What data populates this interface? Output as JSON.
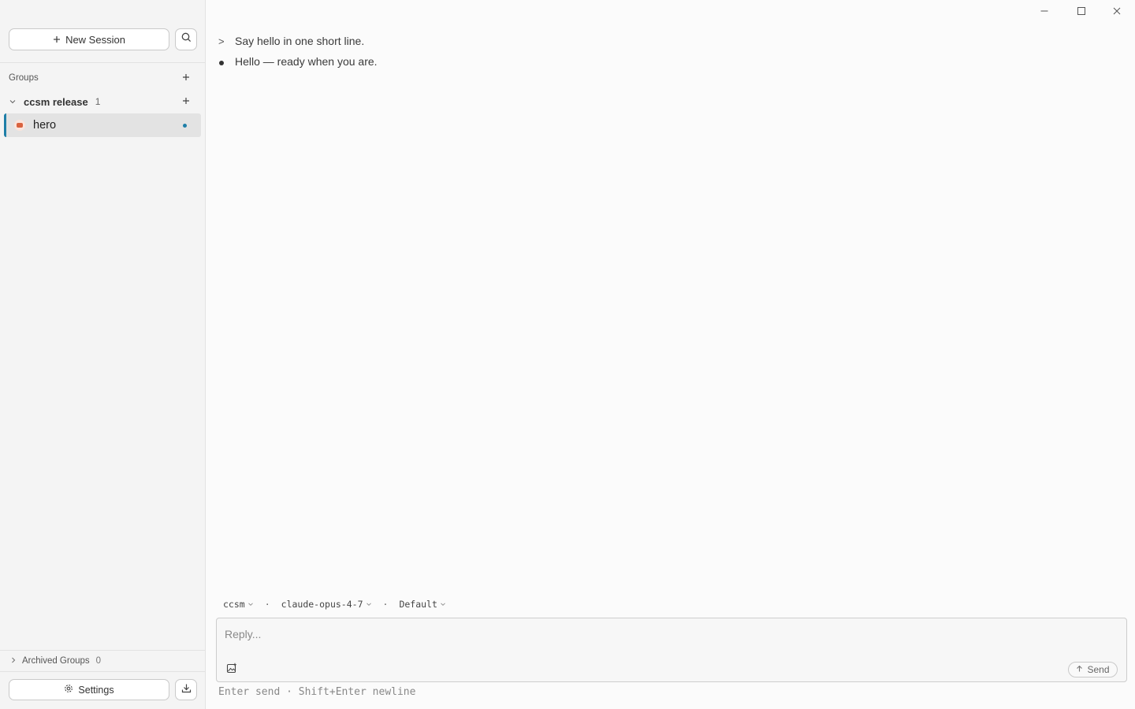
{
  "sidebar": {
    "new_session_label": "New Session",
    "groups_label": "Groups",
    "group": {
      "name": "ccsm release",
      "count": "1"
    },
    "session": {
      "name": "hero"
    },
    "archived": {
      "label": "Archived Groups",
      "count": "0"
    },
    "settings_label": "Settings"
  },
  "chat": {
    "user_marker": ">",
    "user_message": "Say hello in one short line.",
    "assistant_message": "Hello — ready when you are."
  },
  "composer": {
    "project": "ccsm",
    "separator": "·",
    "model": "claude-opus-4-7",
    "mode": "Default",
    "placeholder": "Reply...",
    "send_label": "Send",
    "hint": "Enter send · Shift+Enter newline"
  },
  "colors": {
    "accent": "#1f7fa8",
    "avatar": "#d9623f",
    "sidebar_bg": "#f4f4f4",
    "selected_bg": "#e3e3e3"
  },
  "icons": [
    "plus-icon",
    "search-icon",
    "chevron-down-icon",
    "chevron-right-icon",
    "gear-icon",
    "download-icon",
    "minimize-icon",
    "maximize-icon",
    "close-icon",
    "image-attach-icon",
    "arrow-up-icon"
  ]
}
